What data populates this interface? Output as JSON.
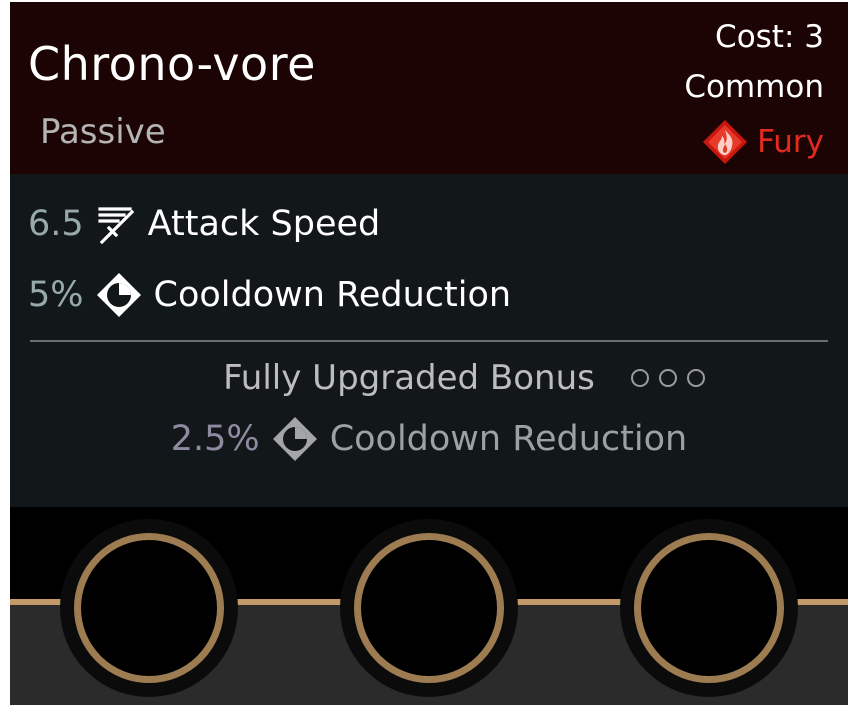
{
  "card": {
    "title": "Chrono-vore",
    "type": "Passive",
    "cost": "Cost: 3",
    "rarity": "Common",
    "faction": {
      "label": "Fury",
      "icon": "fury-flame-icon",
      "color": "#e22a20"
    }
  },
  "stats": [
    {
      "value": "6.5",
      "icon": "attack-speed-icon",
      "label": "Attack Speed"
    },
    {
      "value": "5%",
      "icon": "cooldown-clock-icon",
      "label": "Cooldown Reduction"
    }
  ],
  "bonus": {
    "title": "Fully Upgraded Bonus",
    "upgrade_level": 0,
    "upgrade_max": 3,
    "stat": {
      "value": "2.5%",
      "icon": "cooldown-clock-icon",
      "label": "Cooldown Reduction"
    }
  },
  "slots": [
    {
      "filled": false
    },
    {
      "filled": false
    },
    {
      "filled": false
    }
  ]
}
